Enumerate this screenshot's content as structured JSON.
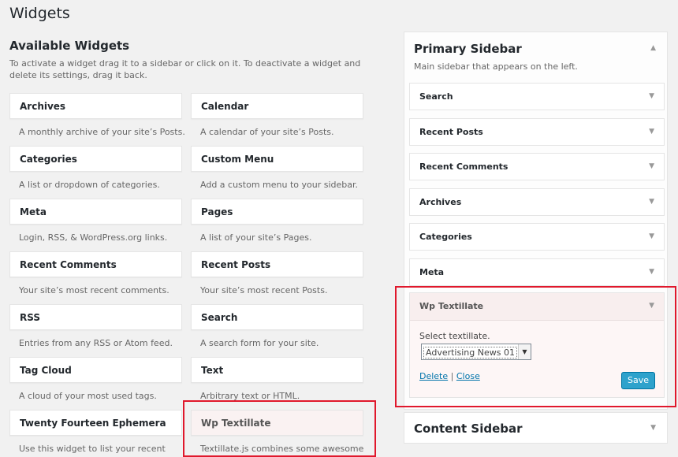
{
  "page_title": "Widgets",
  "available": {
    "title": "Available Widgets",
    "description": "To activate a widget drag it to a sidebar or click on it. To deactivate a widget and delete its settings, drag it back.",
    "widgets": [
      {
        "title": "Archives",
        "desc": "A monthly archive of your site’s Posts."
      },
      {
        "title": "Calendar",
        "desc": "A calendar of your site’s Posts."
      },
      {
        "title": "Categories",
        "desc": "A list or dropdown of categories."
      },
      {
        "title": "Custom Menu",
        "desc": "Add a custom menu to your sidebar."
      },
      {
        "title": "Meta",
        "desc": "Login, RSS, & WordPress.org links."
      },
      {
        "title": "Pages",
        "desc": "A list of your site’s Pages."
      },
      {
        "title": "Recent Comments",
        "desc": "Your site’s most recent comments."
      },
      {
        "title": "Recent Posts",
        "desc": "Your site’s most recent Posts."
      },
      {
        "title": "RSS",
        "desc": "Entries from any RSS or Atom feed."
      },
      {
        "title": "Search",
        "desc": "A search form for your site."
      },
      {
        "title": "Tag Cloud",
        "desc": "A cloud of your most used tags."
      },
      {
        "title": "Text",
        "desc": "Arbitrary text or HTML."
      },
      {
        "title": "Twenty Fourteen Ephemera",
        "desc": "Use this widget to list your recent"
      },
      {
        "title": "Wp Textillate",
        "desc": "Textillate.js combines some awesome"
      }
    ]
  },
  "primary_sidebar": {
    "title": "Primary Sidebar",
    "description": "Main sidebar that appears on the left.",
    "items": [
      "Search",
      "Recent Posts",
      "Recent Comments",
      "Archives",
      "Categories",
      "Meta"
    ],
    "open_widget": {
      "title": "Wp Textillate",
      "select_label": "Select textillate.",
      "select_value": "Advertising News 01",
      "delete_label": "Delete",
      "separator": "|",
      "close_label": "Close",
      "save_label": "Save"
    }
  },
  "content_sidebar": {
    "title": "Content Sidebar"
  },
  "icons": {
    "collapse": "▲",
    "expand": "▼",
    "select_arrow": "▼"
  },
  "colors": {
    "highlight": "#e0182c",
    "primary_button": "#2ea2cc",
    "link": "#0073aa"
  }
}
